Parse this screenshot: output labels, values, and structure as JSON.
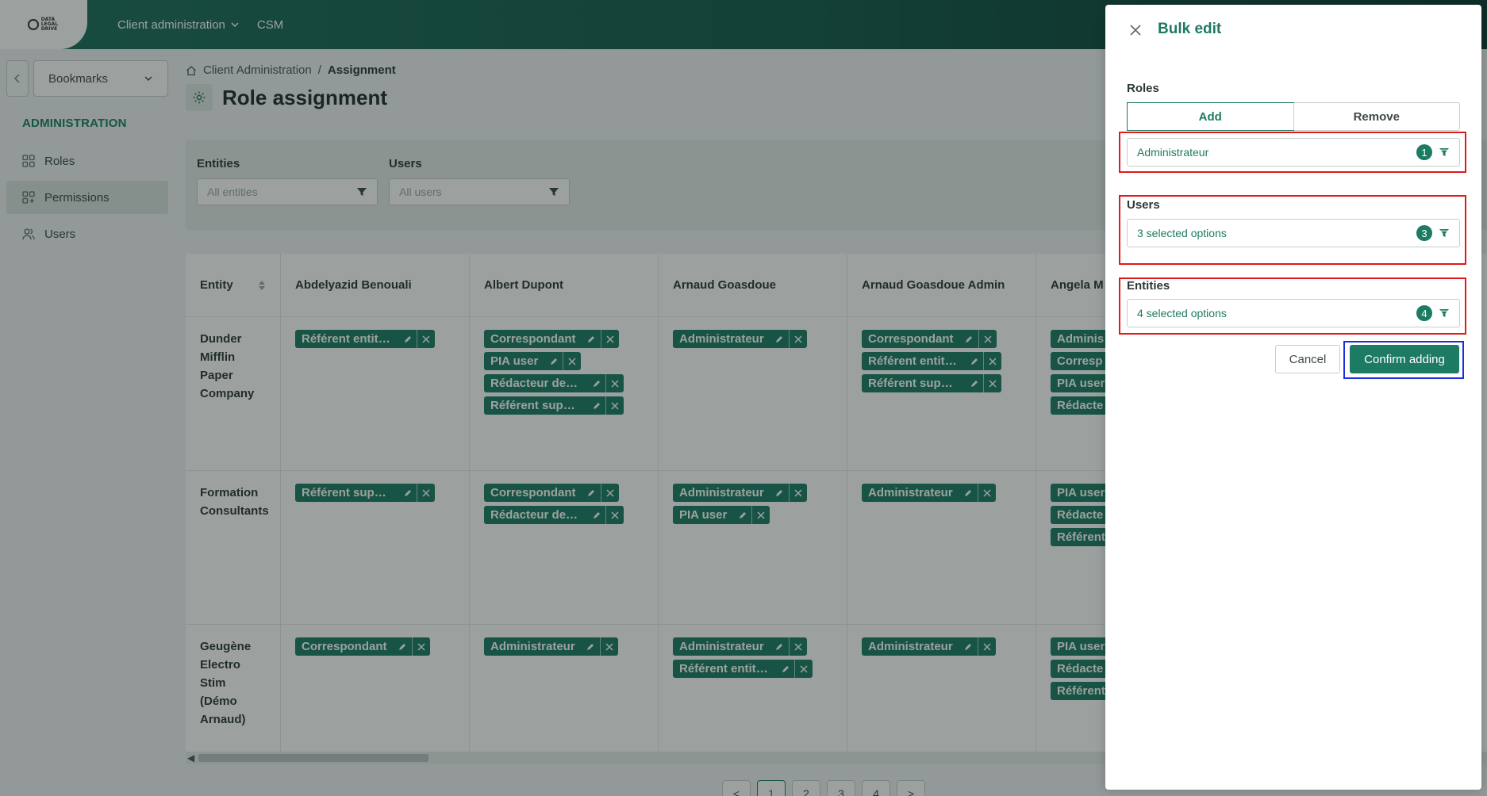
{
  "topbar": {
    "logo_text": "DATA LEGAL DRIVE",
    "nav": [
      {
        "label": "Client administration"
      },
      {
        "label": "CSM"
      }
    ]
  },
  "sidebar": {
    "bookmarks_label": "Bookmarks",
    "section_title": "ADMINISTRATION",
    "items": [
      {
        "label": "Roles",
        "icon": "grid-icon"
      },
      {
        "label": "Permissions",
        "icon": "grid-plus-icon"
      },
      {
        "label": "Users",
        "icon": "users-icon"
      }
    ]
  },
  "breadcrumb": {
    "home": "Client Administration",
    "separator": "/",
    "current": "Assignment"
  },
  "page_title": "Role assignment",
  "filters": {
    "entities_label": "Entities",
    "entities_placeholder": "All entities",
    "users_label": "Users",
    "users_placeholder": "All users"
  },
  "grid": {
    "entity_header": "Entity",
    "users": [
      "Abdelyazid Benouali",
      "Albert Dupont",
      "Arnaud Goasdoue",
      "Arnaud Goasdoue Admin",
      "Angela M"
    ],
    "rows": [
      {
        "entity": "Dunder Mifflin Paper Company",
        "roles": [
          [
            "Référent entité ..."
          ],
          [
            "Correspondant",
            "PIA user",
            "Rédacteur de tra...",
            "Référent supplé..."
          ],
          [
            "Administrateur"
          ],
          [
            "Correspondant",
            "Référent entité -...",
            "Référent supplé..."
          ],
          [
            "Adminis",
            "Corresp",
            "PIA user",
            "Rédacte"
          ]
        ]
      },
      {
        "entity": "Formation Consultants",
        "roles": [
          [
            "Référent supplé..."
          ],
          [
            "Correspondant",
            "Rédacteur de tra..."
          ],
          [
            "Administrateur",
            "PIA user"
          ],
          [
            "Administrateur"
          ],
          [
            "PIA user",
            "Rédacte",
            "Référent"
          ]
        ]
      },
      {
        "entity": "Geugène Electro Stim (Démo Arnaud)",
        "roles": [
          [
            "Correspondant"
          ],
          [
            "Administrateur"
          ],
          [
            "Administrateur",
            "Référent entité ..."
          ],
          [
            "Administrateur"
          ],
          [
            "PIA user",
            "Rédacte",
            "Référent"
          ]
        ]
      }
    ]
  },
  "pagination": {
    "prev": "<",
    "pages": [
      "1",
      "2",
      "3",
      "4"
    ],
    "next": ">",
    "current": "1"
  },
  "drawer": {
    "title": "Bulk edit",
    "roles_label": "Roles",
    "mode_add": "Add",
    "mode_remove": "Remove",
    "roles_value": "Administrateur",
    "roles_count": "1",
    "users_label": "Users",
    "users_value": "3 selected options",
    "users_count": "3",
    "entities_label": "Entities",
    "entities_value": "4 selected options",
    "entities_count": "4",
    "cancel_label": "Cancel",
    "confirm_label": "Confirm adding"
  },
  "colors": {
    "brand": "#1d7a63",
    "highlight_red": "#e01a1a",
    "highlight_blue": "#1a2ee0"
  }
}
